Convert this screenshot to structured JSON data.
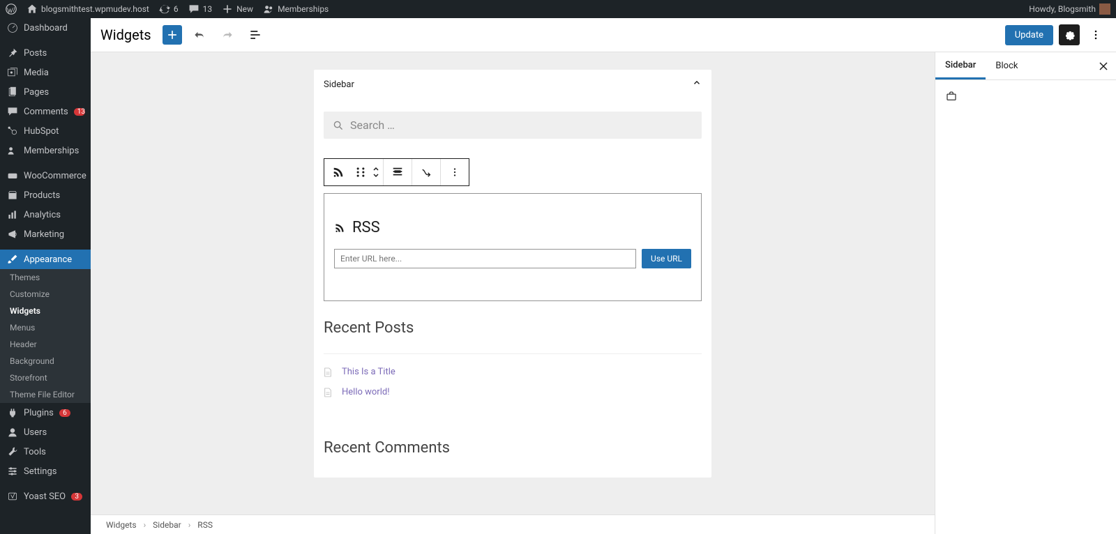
{
  "adminbar": {
    "site_name": "blogsmithtest.wpmudev.host",
    "updates_count": "6",
    "comments_count": "13",
    "new_label": "New",
    "memberships_label": "Memberships",
    "greeting": "Howdy, Blogsmith"
  },
  "sidebar_menu": {
    "dashboard": "Dashboard",
    "posts": "Posts",
    "media": "Media",
    "pages": "Pages",
    "comments": "Comments",
    "comments_badge": "13",
    "hubspot": "HubSpot",
    "memberships": "Memberships",
    "woocommerce": "WooCommerce",
    "products": "Products",
    "analytics": "Analytics",
    "marketing": "Marketing",
    "appearance": "Appearance",
    "appearance_sub": {
      "themes": "Themes",
      "customize": "Customize",
      "widgets": "Widgets",
      "menus": "Menus",
      "header": "Header",
      "background": "Background",
      "storefront": "Storefront",
      "theme_file_editor": "Theme File Editor"
    },
    "plugins": "Plugins",
    "plugins_badge": "6",
    "users": "Users",
    "tools": "Tools",
    "settings": "Settings",
    "yoast": "Yoast SEO",
    "yoast_badge": "3"
  },
  "editor": {
    "title": "Widgets",
    "update_button": "Update",
    "area_title": "Sidebar",
    "search_placeholder": "Search …",
    "rss_title": "RSS",
    "rss_input_placeholder": "Enter URL here...",
    "rss_button": "Use URL",
    "recent_posts_title": "Recent Posts",
    "recent_posts": [
      "This Is a Title",
      "Hello world!"
    ],
    "recent_comments_title": "Recent Comments"
  },
  "inspector": {
    "tab_sidebar": "Sidebar",
    "tab_block": "Block"
  },
  "breadcrumb": [
    "Widgets",
    "Sidebar",
    "RSS"
  ]
}
